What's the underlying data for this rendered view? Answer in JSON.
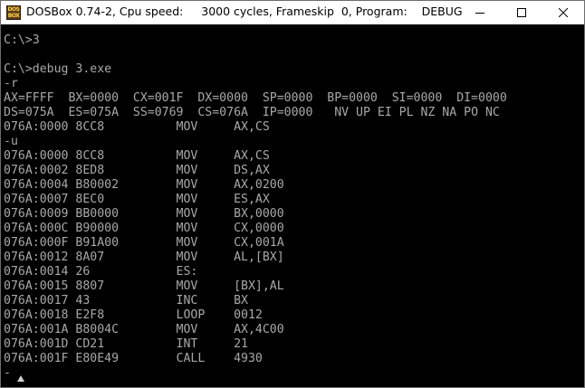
{
  "window": {
    "title": "DOSBox 0.74-2, Cpu speed:     3000 cycles, Frameskip  0, Program:    DEBUG",
    "icon_text": "DOS\nBOX",
    "icon_name": "dosbox-icon"
  },
  "terminal": {
    "lines": [
      "C:\\>3",
      "",
      "C:\\>debug 3.exe",
      "-r",
      "AX=FFFF  BX=0000  CX=001F  DX=0000  SP=0000  BP=0000  SI=0000  DI=0000",
      "DS=075A  ES=075A  SS=0769  CS=076A  IP=0000   NV UP EI PL NZ NA PO NC",
      "076A:0000 8CC8          MOV     AX,CS",
      "-u",
      "076A:0000 8CC8          MOV     AX,CS",
      "076A:0002 8ED8          MOV     DS,AX",
      "076A:0004 B80002        MOV     AX,0200",
      "076A:0007 8EC0          MOV     ES,AX",
      "076A:0009 BB0000        MOV     BX,0000",
      "076A:000C B90000        MOV     CX,0000",
      "076A:000F B91A00        MOV     CX,001A",
      "076A:0012 8A07          MOV     AL,[BX]",
      "076A:0014 26            ES:",
      "076A:0015 8807          MOV     [BX],AL",
      "076A:0017 43            INC     BX",
      "076A:0018 E2F8          LOOP    0012",
      "076A:001A B8004C        MOV     AX,4C00",
      "076A:001D CD21          INT     21",
      "076A:001F E80E49        CALL    4930",
      "-"
    ],
    "colors": {
      "background": "#000000",
      "text": "#a8a8a8"
    }
  }
}
